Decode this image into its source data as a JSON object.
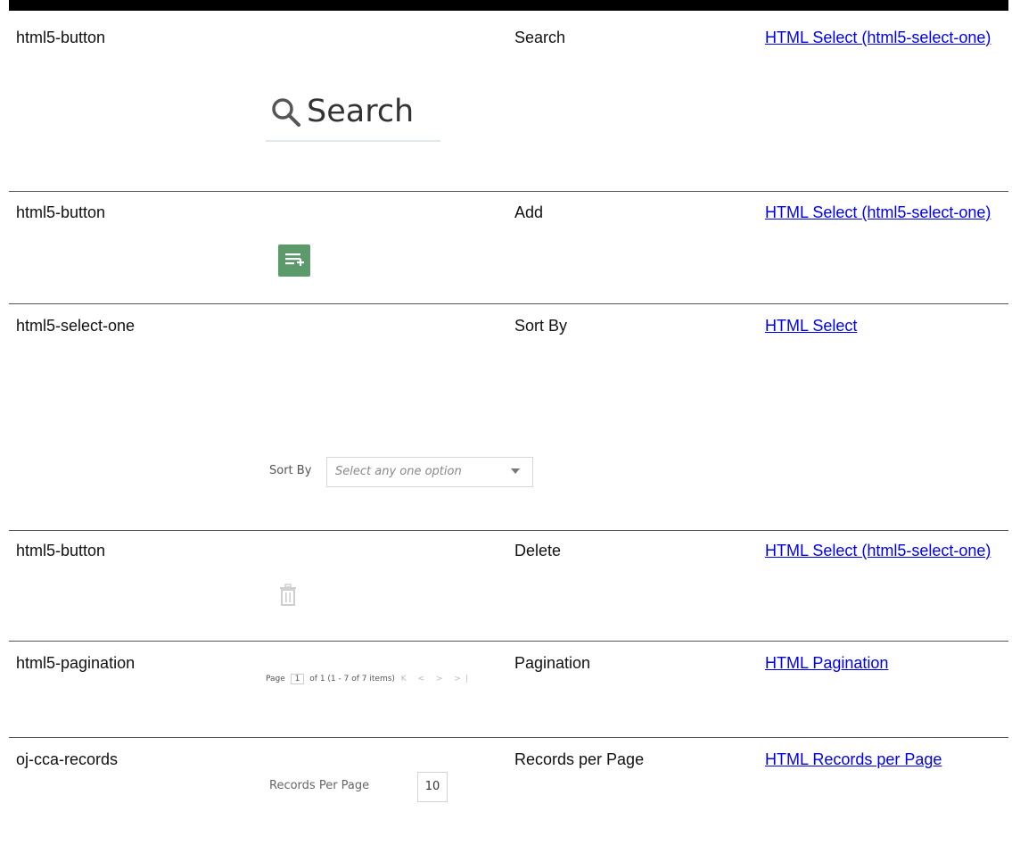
{
  "rows": [
    {
      "type": "html5-button",
      "label": "Search",
      "link": "HTML Select (html5-select-one)",
      "illus": {
        "text": "Search",
        "icon": "search-icon"
      }
    },
    {
      "type": "html5-button",
      "label": "Add",
      "link": "HTML Select (html5-select-one)",
      "illus": {
        "icon": "add-list-icon",
        "color": "#5c9a6c"
      }
    },
    {
      "type": "html5-select-one",
      "label": "Sort By",
      "link": "HTML Select",
      "illus": {
        "label": "Sort By",
        "placeholder": "Select any one option",
        "icon": "chevron-down-icon"
      }
    },
    {
      "type": "html5-button",
      "label": "Delete",
      "link": "HTML Select (html5-select-one)",
      "illus": {
        "icon": "trash-icon"
      }
    },
    {
      "type": "html5-pagination",
      "label": "Pagination",
      "link": "HTML Pagination",
      "illus": {
        "page_label": "Page",
        "page_value": "1",
        "of_text": "of 1",
        "range_text": "(1 - 7 of",
        "total": "7",
        "items_text": "items)",
        "arrows": "K < > >|"
      }
    },
    {
      "type": "oj-cca-records",
      "label": "Records per Page",
      "link": "HTML Records per Page",
      "illus": {
        "label": "Records Per Page",
        "value": "10"
      }
    }
  ]
}
